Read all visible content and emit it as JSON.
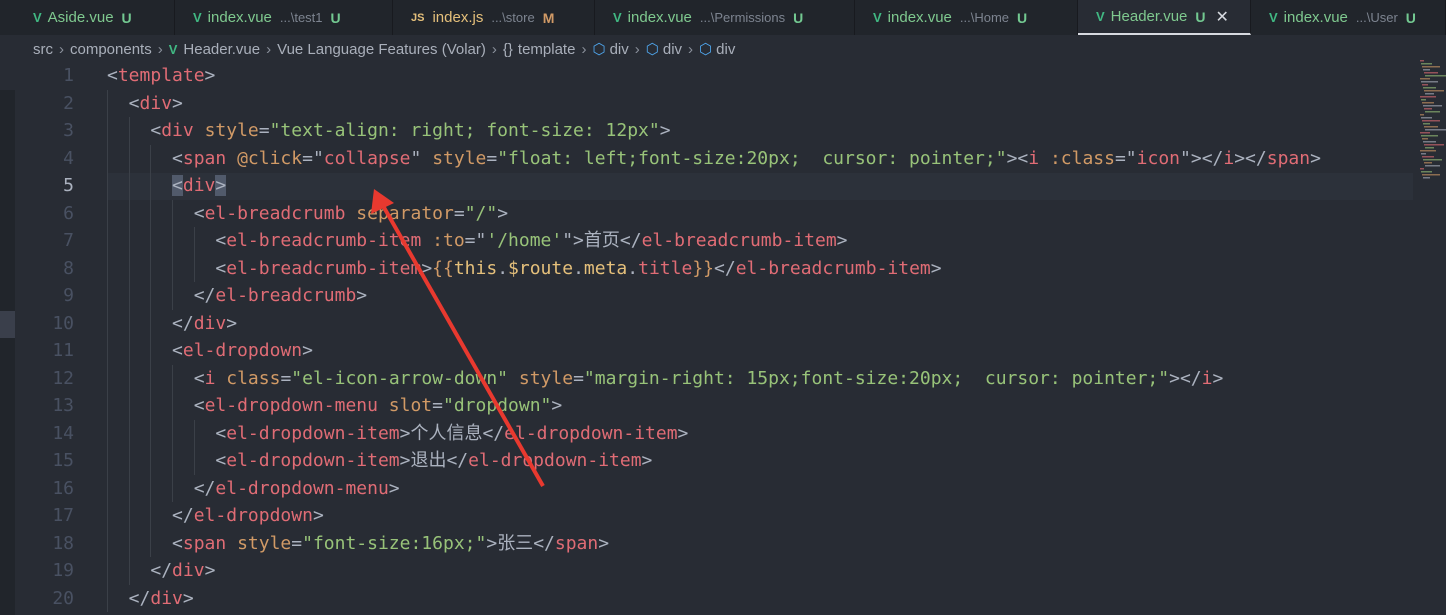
{
  "tabs": [
    {
      "icon": "vue-icon",
      "name": "Aside.vue",
      "desc": "",
      "status": "U",
      "active": false
    },
    {
      "icon": "vue-icon",
      "name": "index.vue",
      "desc": "...\\test1",
      "status": "U",
      "active": false
    },
    {
      "icon": "js-icon",
      "name": "index.js",
      "desc": "...\\store",
      "status": "M",
      "active": false
    },
    {
      "icon": "vue-icon",
      "name": "index.vue",
      "desc": "...\\Permissions",
      "status": "U",
      "active": false
    },
    {
      "icon": "vue-icon",
      "name": "index.vue",
      "desc": "...\\Home",
      "status": "U",
      "active": false
    },
    {
      "icon": "vue-icon",
      "name": "Header.vue",
      "desc": "",
      "status": "U",
      "active": true
    },
    {
      "icon": "vue-icon",
      "name": "index.vue",
      "desc": "...\\User",
      "status": "U",
      "active": false
    }
  ],
  "icons": {
    "vue": "V",
    "js": "JS",
    "close": "✕",
    "sep": "›",
    "braces": "{}",
    "cube": "⬡"
  },
  "breadcrumb": [
    "src",
    "components",
    "Header.vue",
    "Vue Language Features (Volar)",
    "template",
    "div",
    "div",
    "div"
  ],
  "current_line": 5,
  "colors": {
    "tag": "#e06c75",
    "attr": "#d19a66",
    "string": "#98c379",
    "punct": "#abb2bf",
    "expr": "#e5c07b",
    "arrow": "#e8392f"
  },
  "code": [
    {
      "indent": 0,
      "tokens": [
        [
          "p",
          "<"
        ],
        [
          "t",
          "template"
        ],
        [
          "p",
          ">"
        ]
      ]
    },
    {
      "indent": 1,
      "tokens": [
        [
          "p",
          "<"
        ],
        [
          "t",
          "div"
        ],
        [
          "p",
          ">"
        ]
      ]
    },
    {
      "indent": 2,
      "tokens": [
        [
          "p",
          "<"
        ],
        [
          "t",
          "div"
        ],
        [
          "x",
          " "
        ],
        [
          "a",
          "style"
        ],
        [
          "p",
          "="
        ],
        [
          "s",
          "\"text-align: right; font-size: 12px\""
        ],
        [
          "p",
          ">"
        ]
      ]
    },
    {
      "indent": 3,
      "tokens": [
        [
          "p",
          "<"
        ],
        [
          "t",
          "span"
        ],
        [
          "x",
          " "
        ],
        [
          "a",
          "@click"
        ],
        [
          "p",
          "="
        ],
        [
          "p",
          "\""
        ],
        [
          "e",
          "collapse"
        ],
        [
          "p",
          "\""
        ],
        [
          "x",
          " "
        ],
        [
          "a",
          "style"
        ],
        [
          "p",
          "="
        ],
        [
          "s",
          "\"float: left;font-size:20px;  cursor: pointer;\""
        ],
        [
          "p",
          "><"
        ],
        [
          "t",
          "i"
        ],
        [
          "x",
          " "
        ],
        [
          "a",
          ":class"
        ],
        [
          "p",
          "=\""
        ],
        [
          "e",
          "icon"
        ],
        [
          "p",
          "\"></"
        ],
        [
          "t",
          "i"
        ],
        [
          "p",
          "></"
        ],
        [
          "t",
          "span"
        ],
        [
          "p",
          ">"
        ]
      ]
    },
    {
      "indent": 3,
      "tokens": [
        [
          "p bm",
          "<"
        ],
        [
          "t",
          "div"
        ],
        [
          "p bm",
          ">"
        ]
      ]
    },
    {
      "indent": 4,
      "tokens": [
        [
          "p",
          "<"
        ],
        [
          "t",
          "el-breadcrumb"
        ],
        [
          "x",
          " "
        ],
        [
          "a",
          "separator"
        ],
        [
          "p",
          "="
        ],
        [
          "s",
          "\"/\""
        ],
        [
          "p",
          ">"
        ]
      ]
    },
    {
      "indent": 5,
      "tokens": [
        [
          "p",
          "<"
        ],
        [
          "t",
          "el-breadcrumb-item"
        ],
        [
          "x",
          " "
        ],
        [
          "a",
          ":to"
        ],
        [
          "p",
          "=\""
        ],
        [
          "s",
          "'/home'"
        ],
        [
          "p",
          "\">"
        ],
        [
          "x",
          "首页"
        ],
        [
          "p",
          "</"
        ],
        [
          "t",
          "el-breadcrumb-item"
        ],
        [
          "p",
          ">"
        ]
      ]
    },
    {
      "indent": 5,
      "tokens": [
        [
          "p",
          "<"
        ],
        [
          "t",
          "el-breadcrumb-item"
        ],
        [
          "p",
          ">"
        ],
        [
          "a",
          "{{"
        ],
        [
          "y",
          "this"
        ],
        [
          "p",
          "."
        ],
        [
          "y",
          "$route"
        ],
        [
          "p",
          "."
        ],
        [
          "y",
          "meta"
        ],
        [
          "p",
          "."
        ],
        [
          "e",
          "title"
        ],
        [
          "a",
          "}}"
        ],
        [
          "p",
          "</"
        ],
        [
          "t",
          "el-breadcrumb-item"
        ],
        [
          "p",
          ">"
        ]
      ]
    },
    {
      "indent": 4,
      "tokens": [
        [
          "p",
          "</"
        ],
        [
          "t",
          "el-breadcrumb"
        ],
        [
          "p",
          ">"
        ]
      ]
    },
    {
      "indent": 3,
      "tokens": [
        [
          "p",
          "</"
        ],
        [
          "t",
          "div"
        ],
        [
          "p",
          ">"
        ]
      ]
    },
    {
      "indent": 3,
      "tokens": [
        [
          "p",
          "<"
        ],
        [
          "t",
          "el-dropdown"
        ],
        [
          "p",
          ">"
        ]
      ]
    },
    {
      "indent": 4,
      "tokens": [
        [
          "p",
          "<"
        ],
        [
          "t",
          "i"
        ],
        [
          "x",
          " "
        ],
        [
          "a",
          "class"
        ],
        [
          "p",
          "="
        ],
        [
          "s",
          "\"el-icon-arrow-down\""
        ],
        [
          "x",
          " "
        ],
        [
          "a",
          "style"
        ],
        [
          "p",
          "="
        ],
        [
          "s",
          "\"margin-right: 15px;font-size:20px;  cursor: pointer;\""
        ],
        [
          "p",
          "></"
        ],
        [
          "t",
          "i"
        ],
        [
          "p",
          ">"
        ]
      ]
    },
    {
      "indent": 4,
      "tokens": [
        [
          "p",
          "<"
        ],
        [
          "t",
          "el-dropdown-menu"
        ],
        [
          "x",
          " "
        ],
        [
          "a",
          "slot"
        ],
        [
          "p",
          "="
        ],
        [
          "s",
          "\"dropdown\""
        ],
        [
          "p",
          ">"
        ]
      ]
    },
    {
      "indent": 5,
      "tokens": [
        [
          "p",
          "<"
        ],
        [
          "t",
          "el-dropdown-item"
        ],
        [
          "p",
          ">"
        ],
        [
          "x",
          "个人信息"
        ],
        [
          "p",
          "</"
        ],
        [
          "t",
          "el-dropdown-item"
        ],
        [
          "p",
          ">"
        ]
      ]
    },
    {
      "indent": 5,
      "tokens": [
        [
          "p",
          "<"
        ],
        [
          "t",
          "el-dropdown-item"
        ],
        [
          "p",
          ">"
        ],
        [
          "x",
          "退出"
        ],
        [
          "p",
          "</"
        ],
        [
          "t",
          "el-dropdown-item"
        ],
        [
          "p",
          ">"
        ]
      ]
    },
    {
      "indent": 4,
      "tokens": [
        [
          "p",
          "</"
        ],
        [
          "t",
          "el-dropdown-menu"
        ],
        [
          "p",
          ">"
        ]
      ]
    },
    {
      "indent": 3,
      "tokens": [
        [
          "p",
          "</"
        ],
        [
          "t",
          "el-dropdown"
        ],
        [
          "p",
          ">"
        ]
      ]
    },
    {
      "indent": 3,
      "tokens": [
        [
          "p",
          "<"
        ],
        [
          "t",
          "span"
        ],
        [
          "x",
          " "
        ],
        [
          "a",
          "style"
        ],
        [
          "p",
          "="
        ],
        [
          "s",
          "\"font-size:16px;\""
        ],
        [
          "p",
          ">"
        ],
        [
          "x",
          "张三"
        ],
        [
          "p",
          "</"
        ],
        [
          "t",
          "span"
        ],
        [
          "p",
          ">"
        ]
      ]
    },
    {
      "indent": 2,
      "tokens": [
        [
          "p",
          "</"
        ],
        [
          "t",
          "div"
        ],
        [
          "p",
          ">"
        ]
      ]
    },
    {
      "indent": 1,
      "tokens": [
        [
          "p",
          "</"
        ],
        [
          "t",
          "div"
        ],
        [
          "p",
          ">"
        ]
      ]
    }
  ]
}
